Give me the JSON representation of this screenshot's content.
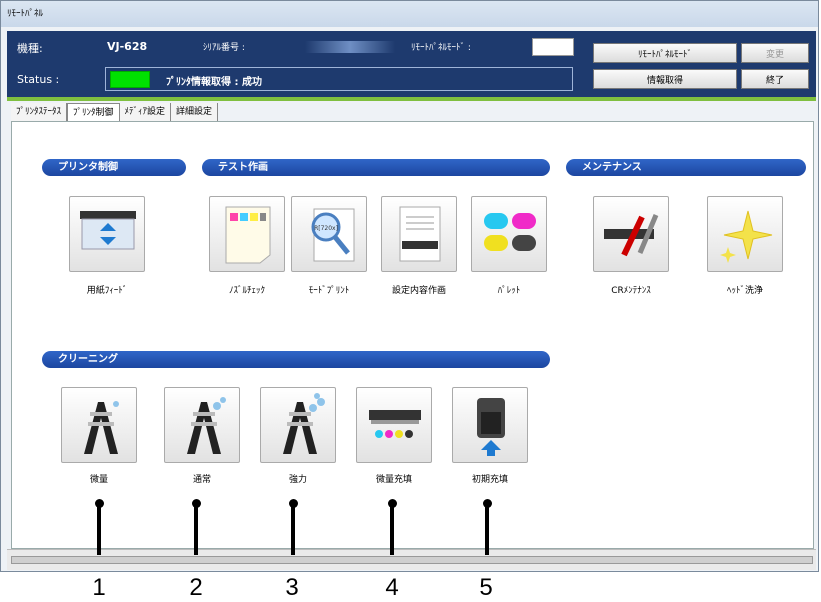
{
  "window": {
    "title": "ﾘﾓｰﾄﾊﾟﾈﾙ"
  },
  "header": {
    "model_label": "機種:",
    "model_value": "VJ-628",
    "serial_label": "ｼﾘｱﾙ番号 :",
    "remote_mode_label": "ﾘﾓｰﾄﾊﾟﾈﾙﾓｰﾄﾞ :",
    "status_label": "Status :",
    "status_text": "ﾌﾟﾘﾝﾀ情報取得 : 成功",
    "status_color": "#00e000",
    "buttons": {
      "remote_mode": "ﾘﾓｰﾄﾊﾟﾈﾙﾓｰﾄﾞ",
      "change": "変更",
      "get_info": "情報取得",
      "exit": "終了"
    }
  },
  "tabs": [
    "ﾌﾟﾘﾝﾀｽﾃｰﾀｽ",
    "ﾌﾟﾘﾝﾀ制御",
    "ﾒﾃﾞｨｱ設定",
    "詳細設定"
  ],
  "active_tab": "ﾌﾟﾘﾝﾀ制御",
  "sections": {
    "printer_control": {
      "title": "プリンタ制御",
      "buttons": [
        {
          "label": "用紙ﾌｨｰﾄﾞ",
          "icon": "paper-feed-icon"
        }
      ]
    },
    "test_print": {
      "title": "テスト作画",
      "buttons": [
        {
          "label": "ﾉｽﾞﾙﾁｪｯｸ",
          "icon": "nozzle-check-icon"
        },
        {
          "label": "ﾓｰﾄﾞﾌﾟﾘﾝﾄ",
          "icon": "mode-print-icon",
          "icon_text": "R[720x]"
        },
        {
          "label": "設定内容作画",
          "icon": "settings-print-icon"
        },
        {
          "label": "ﾊﾟﾚｯﾄ",
          "icon": "palette-icon"
        }
      ]
    },
    "maintenance": {
      "title": "メンテナンス",
      "buttons": [
        {
          "label": "CRﾒﾝﾃﾅﾝｽ",
          "icon": "cr-maintenance-icon"
        },
        {
          "label": "ﾍｯﾄﾞ洗浄",
          "icon": "head-cleaning-icon"
        }
      ]
    },
    "cleaning": {
      "title": "クリーニング",
      "buttons": [
        {
          "label": "微量",
          "icon": "cleaning-light-icon"
        },
        {
          "label": "通常",
          "icon": "cleaning-normal-icon"
        },
        {
          "label": "強力",
          "icon": "cleaning-strong-icon"
        },
        {
          "label": "微量充填",
          "icon": "ink-fill-light-icon"
        },
        {
          "label": "初期充填",
          "icon": "ink-fill-initial-icon"
        }
      ]
    }
  },
  "callouts": [
    "1",
    "2",
    "3",
    "4",
    "5"
  ]
}
